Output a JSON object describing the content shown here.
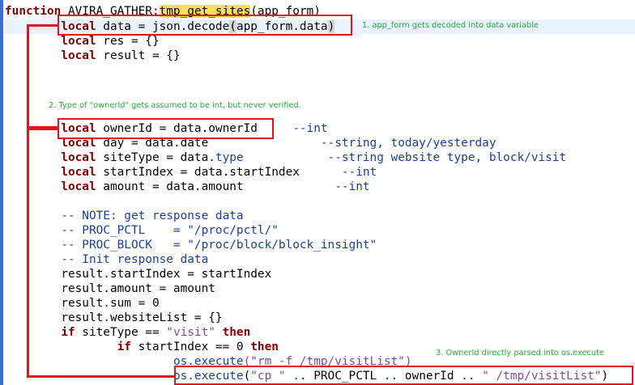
{
  "code": {
    "l1": {
      "kw": "function",
      "pre": " AVIRA_GATHER:",
      "fn": "tmp_get_sites",
      "post": "(app_form)"
    },
    "l2": {
      "kw": "local",
      "pre": " data = json.decode",
      "b1": "(",
      "mid": "app_form.data",
      "b2": ")"
    },
    "l3": {
      "kw": "local",
      "rest": " res = {}"
    },
    "l4": {
      "kw": "local",
      "rest": " result = {}"
    },
    "l5": {
      "kw": "local",
      "rest": " ownerId = data.ownerId",
      "cm": "     --int"
    },
    "l6": {
      "kw": "local",
      "rest": " day = data.date",
      "cm": "                --string, today/yesterday"
    },
    "l7": {
      "kw": "local",
      "rest": " siteType = data.",
      "mt": "type",
      "cm": "            --string website type, block/visit"
    },
    "l8": {
      "kw": "local",
      "rest": " startIndex = data.startIndex",
      "cm": "      --int"
    },
    "l9": {
      "kw": "local",
      "rest": " amount = data.amount",
      "cm": "             --int"
    },
    "l10": "-- NOTE: get response data",
    "l11": "-- PROC_PCTL    = \"/proc/pctl/\"",
    "l12": "-- PROC_BLOCK   = \"/proc/block/block_insight\"",
    "l13": "-- Init response data",
    "l14": "result.startIndex = startIndex",
    "l15": "result.amount = amount",
    "l16": "result.sum = 0",
    "l17": "result.websiteList = {}",
    "l18": {
      "kw1": "if",
      "rest": " siteType == ",
      "st": "\"visit\"",
      "kw2": "then"
    },
    "l19": {
      "kw1": "if",
      "rest": " startIndex == 0 ",
      "kw2": "then"
    },
    "l20": {
      "mt": "os.execute",
      "st": "(\"rm -f /tmp/visitList\")"
    },
    "l21": {
      "mt": "os.execute",
      "a": "(",
      "st1": "\"cp \"",
      "mid": " .. PROC_PCTL .. ownerId .. ",
      "st2": "\" /tmp/visitList\"",
      "b": ")"
    }
  },
  "annotations": {
    "note1": "1. app_form gets decoded into data variable",
    "note2": "2. Type of \"ownerId\" gets assumed to be int, but never verified.",
    "note3": "3. OwnerId directly parsed into os.execute"
  },
  "colors": {
    "keyword": "#800000",
    "comment": "#1a3f9e",
    "string": "#8a4a8a",
    "highlight": "#f6e15b",
    "annotation_box": "#e0161c",
    "annotation_text": "#27ae35"
  }
}
